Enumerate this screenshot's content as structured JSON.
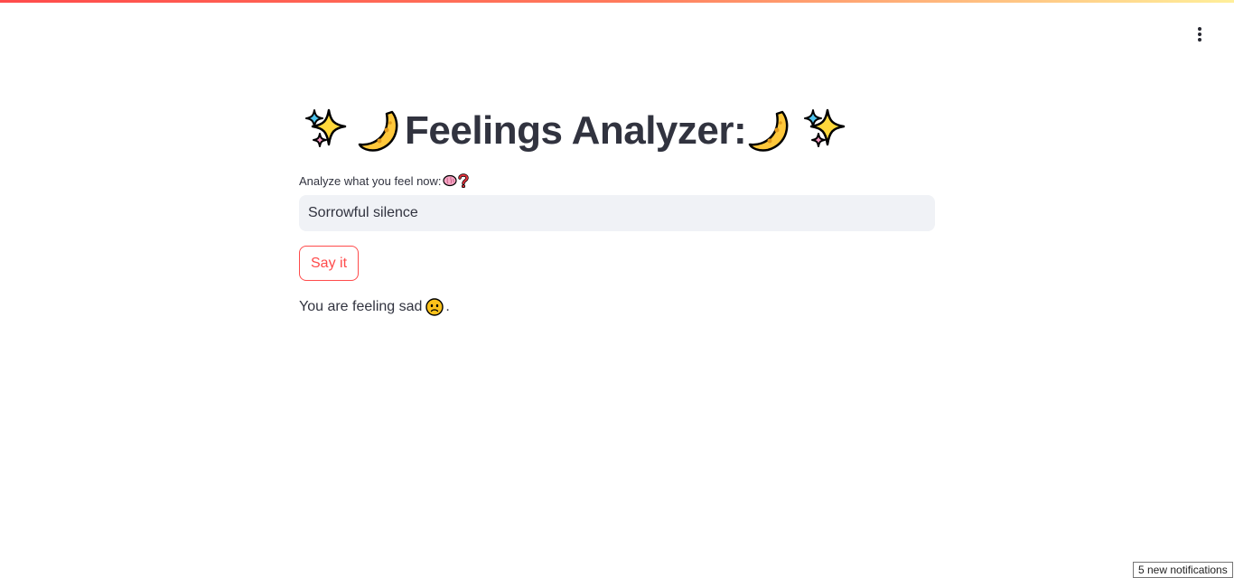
{
  "header": {
    "menu_icon": "vertical-ellipsis-icon"
  },
  "main": {
    "title": {
      "text": "Feelings Analyzer:",
      "icons_before": [
        "sparkles-icon",
        "crescent-moon-icon"
      ],
      "icons_after": [
        "crescent-moon-icon",
        "sparkles-icon"
      ]
    },
    "input": {
      "label": "Analyze what you feel now:",
      "label_icons": [
        "brain-icon",
        "question-mark-icon"
      ],
      "value": "Sorrowful silence"
    },
    "button": {
      "label": "Say it"
    },
    "result": {
      "prefix": "You are feeling sad",
      "icon": "slightly-frowning-face-icon",
      "suffix": "."
    }
  },
  "footer": {
    "notifications": "5 new notifications"
  },
  "colors": {
    "accent": "#ff4b4b",
    "text": "#31333f",
    "input_bg": "#f0f2f6"
  }
}
